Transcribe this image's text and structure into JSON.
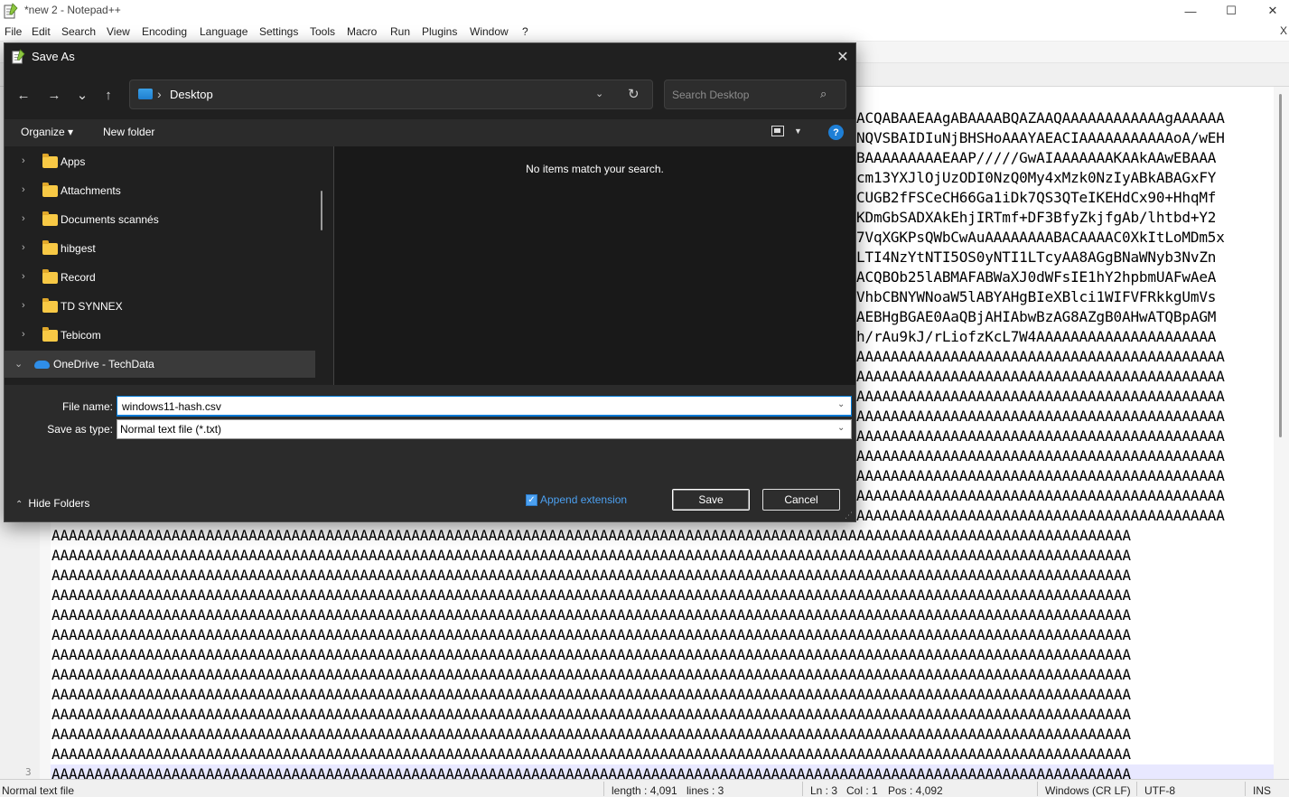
{
  "npp": {
    "title": "*new 2 - Notepad++",
    "window_controls": {
      "minimize": "—",
      "maximize": "☐",
      "close": "✕"
    },
    "menu": [
      "File",
      "Edit",
      "Search",
      "View",
      "Encoding",
      "Language",
      "Settings",
      "Tools",
      "Macro",
      "Run",
      "Plugins",
      "Window",
      "?"
    ],
    "menu_close": "X",
    "gutter_line": "3",
    "code_right_lines": [
      "ACQABAAEAAgABAAAABQAZAAQAAAAAAAAAAAAgAAAAAA",
      "NQVSBAIDIuNjBHSHoAAAYAEACIAAAAAAAAAAAoA/wEH",
      "BAAAAAAAAAEAAP/////GwAIAAAAAAAKAAkAAwEBAAA",
      "cm13YXJlOjUzODI0NzQ0My4xMzk0NzIyABkABAGxFY",
      "CUGB2fFSCeCH66Ga1iDk7QS3QTeIKEHdCx90+HhqMf",
      "KDmGbSADXAkEhjIRTmf+DF3BfyZkjfgAb/lhtbd+Y2",
      "7VqXGKPsQWbCwAuAAAAAAAABACAAAAC0XkItLoMDm5x",
      "LTI4NzYtNTI5OS0yNTI1LTcyAA8AGgBNaWNyb3NvZn",
      "ACQBOb25lABMAFABWaXJ0dWFsIE1hY2hpbmUAFwAeA",
      "VhbCBNYWNoaW5lABYAHgBIeXBlci1WIFVFRkkgUmVs",
      "AEBHgBGAE0AaQBjAHIAbwBzAG8AZgB0AHwATQBpAGM",
      "h/rAu9kJ/rLiofzKcL7W4AAAAAAAAAAAAAAAAAAAAA",
      "AAAAAAAAAAAAAAAAAAAAAAAAAAAAAAAAAAAAAAAAAAA",
      "AAAAAAAAAAAAAAAAAAAAAAAAAAAAAAAAAAAAAAAAAAA",
      "AAAAAAAAAAAAAAAAAAAAAAAAAAAAAAAAAAAAAAAAAAA",
      "AAAAAAAAAAAAAAAAAAAAAAAAAAAAAAAAAAAAAAAAAAA",
      "AAAAAAAAAAAAAAAAAAAAAAAAAAAAAAAAAAAAAAAAAAA",
      "AAAAAAAAAAAAAAAAAAAAAAAAAAAAAAAAAAAAAAAAAAA",
      "AAAAAAAAAAAAAAAAAAAAAAAAAAAAAAAAAAAAAAAAAAA",
      "AAAAAAAAAAAAAAAAAAAAAAAAAAAAAAAAAAAAAAAAAAA",
      "AAAAAAAAAAAAAAAAAAAAAAAAAAAAAAAAAAAAAAAAAAA"
    ],
    "code_bottom_lines": [
      "AAAAAAAAAAAAAAAAAAAAAAAAAAAAAAAAAAAAAAAAAAAAAAAAAAAAAAAAAAAAAAAAAAAAAAAAAAAAAAAAAAAAAAAAAAAAAAAAAAAAAAAAAAAAAAAAAAAAAAAAAAAAAA",
      "AAAAAAAAAAAAAAAAAAAAAAAAAAAAAAAAAAAAAAAAAAAAAAAAAAAAAAAAAAAAAAAAAAAAAAAAAAAAAAAAAAAAAAAAAAAAAAAAAAAAAAAAAAAAAAAAAAAAAAAAAAAAAA",
      "AAAAAAAAAAAAAAAAAAAAAAAAAAAAAAAAAAAAAAAAAAAAAAAAAAAAAAAAAAAAAAAAAAAAAAAAAAAAAAAAAAAAAAAAAAAAAAAAAAAAAAAAAAAAAAAAAAAAAAAAAAAAAA",
      "AAAAAAAAAAAAAAAAAAAAAAAAAAAAAAAAAAAAAAAAAAAAAAAAAAAAAAAAAAAAAAAAAAAAAAAAAAAAAAAAAAAAAAAAAAAAAAAAAAAAAAAAAAAAAAAAAAAAAAAAAAAAAA",
      "AAAAAAAAAAAAAAAAAAAAAAAAAAAAAAAAAAAAAAAAAAAAAAAAAAAAAAAAAAAAAAAAAAAAAAAAAAAAAAAAAAAAAAAAAAAAAAAAAAAAAAAAAAAAAAAAAAAAAAAAAAAAAA",
      "AAAAAAAAAAAAAAAAAAAAAAAAAAAAAAAAAAAAAAAAAAAAAAAAAAAAAAAAAAAAAAAAAAAAAAAAAAAAAAAAAAAAAAAAAAAAAAAAAAAAAAAAAAAAAAAAAAAAAAAAAAAAAA",
      "AAAAAAAAAAAAAAAAAAAAAAAAAAAAAAAAAAAAAAAAAAAAAAAAAAAAAAAAAAAAAAAAAAAAAAAAAAAAAAAAAAAAAAAAAAAAAAAAAAAAAAAAAAAAAAAAAAAAAAAAAAAAAA",
      "AAAAAAAAAAAAAAAAAAAAAAAAAAAAAAAAAAAAAAAAAAAAAAAAAAAAAAAAAAAAAAAAAAAAAAAAAAAAAAAAAAAAAAAAAAAAAAAAAAAAAAAAAAAAAAAAAAAAAAAAAAAAAA",
      "AAAAAAAAAAAAAAAAAAAAAAAAAAAAAAAAAAAAAAAAAAAAAAAAAAAAAAAAAAAAAAAAAAAAAAAAAAAAAAAAAAAAAAAAAAAAAAAAAAAAAAAAAAAAAAAAAAAAAAAAAAAAAA",
      "AAAAAAAAAAAAAAAAAAAAAAAAAAAAAAAAAAAAAAAAAAAAAAAAAAAAAAAAAAAAAAAAAAAAAAAAAAAAAAAAAAAAAAAAAAAAAAAAAAAAAAAAAAAAAAAAAAAAAAAAAAAAAA",
      "AAAAAAAAAAAAAAAAAAAAAAAAAAAAAAAAAAAAAAAAAAAAAAAAAAAAAAAAAAAAAAAAAAAAAAAAAAAAAAAAAAAAAAAAAAAAAAAAAAAAAAAAAAAAAAAAAAAAAAAAAAAAAA",
      "AAAAAAAAAAAAAAAAAAAAAAAAAAAAAAAAAAAAAAAAAAAAAAAAAAAAAAAAAAAAAAAAAAAAAAAAAAAAAAAAAAAAAAAAAAAAAAAAAAAAAAAAAAAAAAAAAAAAAAAAAAAAAA",
      "AAAAAAAAAAAAAAAAAAAAAAAAAAAAAAAAAAAAAAAAAAAAAAAAAAAAAAAAAAAAAAAAAAAAAAAAAAAAAAAAAAAAAAAAAAAAAAAAAAAAAAAAAAAAAAAAAAAAAAAAAAAAAA",
      "AAAAAAAAAAAAAAAAAAAAAAAAAAAAAAAAAAAAAAAAAAAAAAAAAAAAAAAAAAAAAAAAAAAAAAAAAAAAAAAAAAAAAAAAAAAAAAAAAAAAAAAAAAAAAAAAAAAAAAAAAAAAAA",
      "AAAAAAAAAAAAAAAAAAAAAAAAAAAAAAAAAAAAAAAAAAAAAAAAAAAAAAAAAAAAAAAAAAAAAAAAAAAAAAAAAAAAAAAAAAAAAAAAAAAAAAAAAAAAAA"
    ],
    "status": {
      "file_type": "Normal text file",
      "length": "length : 4,091",
      "lines": "lines : 3",
      "ln": "Ln : 3",
      "col": "Col : 1",
      "pos": "Pos : 4,092",
      "eol": "Windows (CR LF)",
      "encoding": "UTF-8",
      "mode": "INS"
    }
  },
  "dialog": {
    "title": "Save As",
    "close": "✕",
    "nav": {
      "back": "←",
      "forward": "→",
      "recent": "⌄",
      "up": "↑"
    },
    "address": {
      "separator": "›",
      "location": "Desktop",
      "dropdown": "⌄",
      "refresh": "↻"
    },
    "search": {
      "placeholder": "Search Desktop",
      "icon": "⌕"
    },
    "commandbar": {
      "organize": "Organize ▾",
      "new_folder": "New folder",
      "view_dropdown": "▼",
      "help": "?"
    },
    "tree": [
      {
        "label": "Apps",
        "chevron": "›"
      },
      {
        "label": "Attachments",
        "chevron": "›"
      },
      {
        "label": "Documents scannés",
        "chevron": "›"
      },
      {
        "label": "hibgest",
        "chevron": "›"
      },
      {
        "label": "Record",
        "chevron": "›"
      },
      {
        "label": "TD SYNNEX",
        "chevron": "›"
      },
      {
        "label": "Tebicom",
        "chevron": "›"
      }
    ],
    "onedrive": {
      "label": "OneDrive - TechData",
      "chevron": "⌄"
    },
    "empty_message": "No items match your search.",
    "file_name_label": "File name:",
    "file_name_value": "windows11-hash.csv",
    "save_type_label": "Save as type:",
    "save_type_value": "Normal text file (*.txt)",
    "combo_arrow": "⌄",
    "hide_folders": "Hide Folders",
    "hide_folders_icon": "⌃",
    "append_extension": "Append extension",
    "append_checked_mark": "✓",
    "save_button": "Save",
    "cancel_button": "Cancel",
    "grip": "⋰"
  }
}
